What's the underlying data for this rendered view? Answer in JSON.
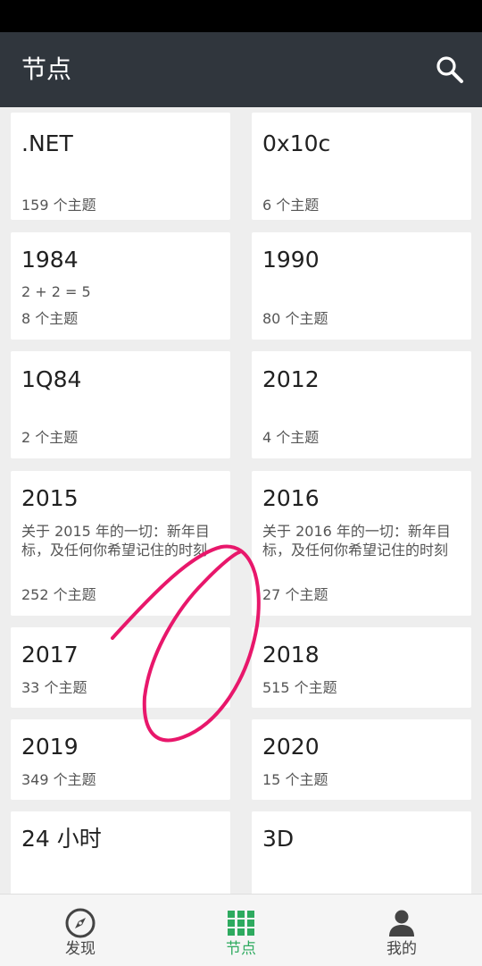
{
  "app_bar": {
    "title": "节点"
  },
  "nodes": [
    {
      "title": ".NET",
      "desc": "",
      "count": "159 个主题"
    },
    {
      "title": "0x10c",
      "desc": "",
      "count": "6 个主题"
    },
    {
      "title": "1984",
      "desc": "2 + 2 = 5",
      "count": "8 个主题"
    },
    {
      "title": "1990",
      "desc": "",
      "count": "80 个主题"
    },
    {
      "title": "1Q84",
      "desc": "",
      "count": "2 个主题"
    },
    {
      "title": "2012",
      "desc": "",
      "count": "4 个主题"
    },
    {
      "title": "2015",
      "desc": "关于 2015 年的一切：新年目标，及任何你希望记住的时刻",
      "count": "252 个主题"
    },
    {
      "title": "2016",
      "desc": "关于 2016 年的一切：新年目标，及任何你希望记住的时刻",
      "count": "27 个主题"
    },
    {
      "title": "2017",
      "desc": "",
      "count": "33 个主题"
    },
    {
      "title": "2018",
      "desc": "",
      "count": "515 个主题"
    },
    {
      "title": "2019",
      "desc": "",
      "count": "349 个主题"
    },
    {
      "title": "2020",
      "desc": "",
      "count": "15 个主题"
    },
    {
      "title": "24 小时",
      "desc": "",
      "count": ""
    },
    {
      "title": "3D",
      "desc": "",
      "count": ""
    }
  ],
  "bottom_nav": {
    "items": [
      {
        "label": "发现",
        "icon": "compass-icon"
      },
      {
        "label": "节点",
        "icon": "grid-icon"
      },
      {
        "label": "我的",
        "icon": "person-icon"
      }
    ],
    "active_index": 1,
    "active_color": "#2eaa5f",
    "inactive_color": "#444444"
  },
  "colors": {
    "app_bar": "#30363d",
    "annotation_stroke": "#e8176b"
  }
}
